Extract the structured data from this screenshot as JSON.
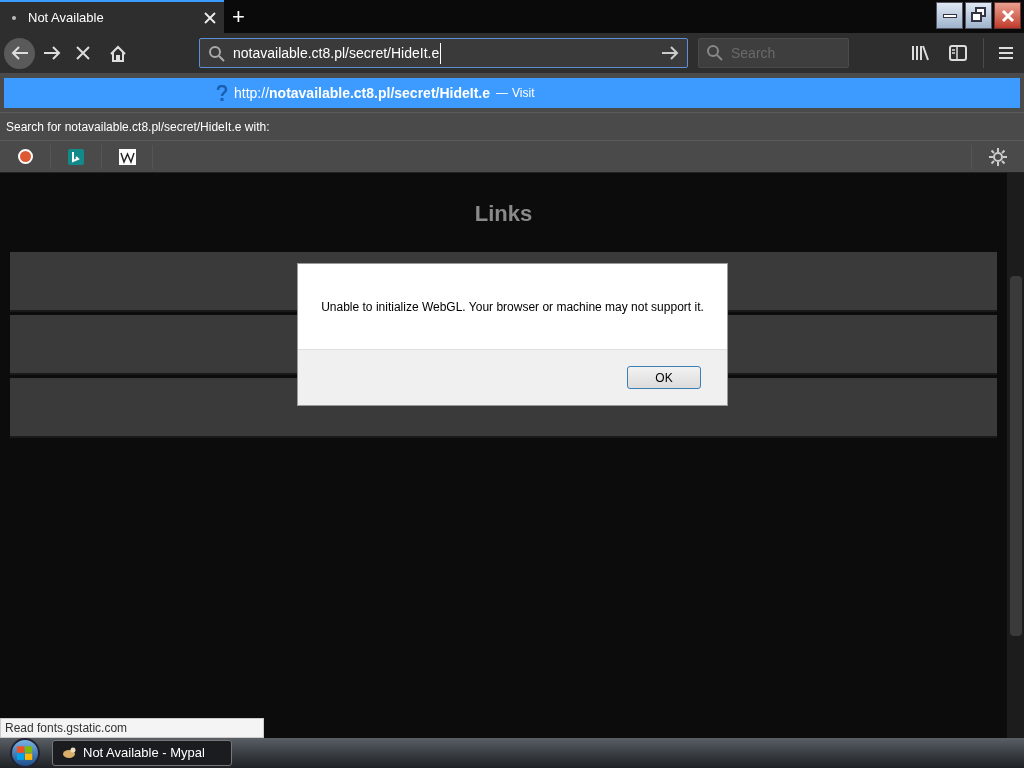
{
  "tabs": [
    {
      "title": "Not Available",
      "selected": true
    }
  ],
  "new_tab": "+",
  "address_bar": {
    "value": "notavailable.ct8.pl/secret/HideIt.e"
  },
  "search_field": {
    "placeholder": "Search"
  },
  "suggestion": {
    "url": "http://**notavailable.ct8.pl/secret/HideIt.e**",
    "separator": "—",
    "action": "Visit"
  },
  "search_with": "Search for notavailable.ct8.pl/secret/HideIt.e with:",
  "search_engines": [
    {
      "kind": "duck"
    },
    {
      "kind": "bing"
    },
    {
      "kind": "wiki"
    }
  ],
  "page": {
    "heading": "Links"
  },
  "dialog": {
    "message": "Unable to initialize WebGL. Your browser or machine may not support it.",
    "button": "OK"
  },
  "status_text": "Read fonts.gstatic.com",
  "taskbar": {
    "items": [
      {
        "label": "Not Available - Mypal",
        "selected": true
      }
    ]
  }
}
